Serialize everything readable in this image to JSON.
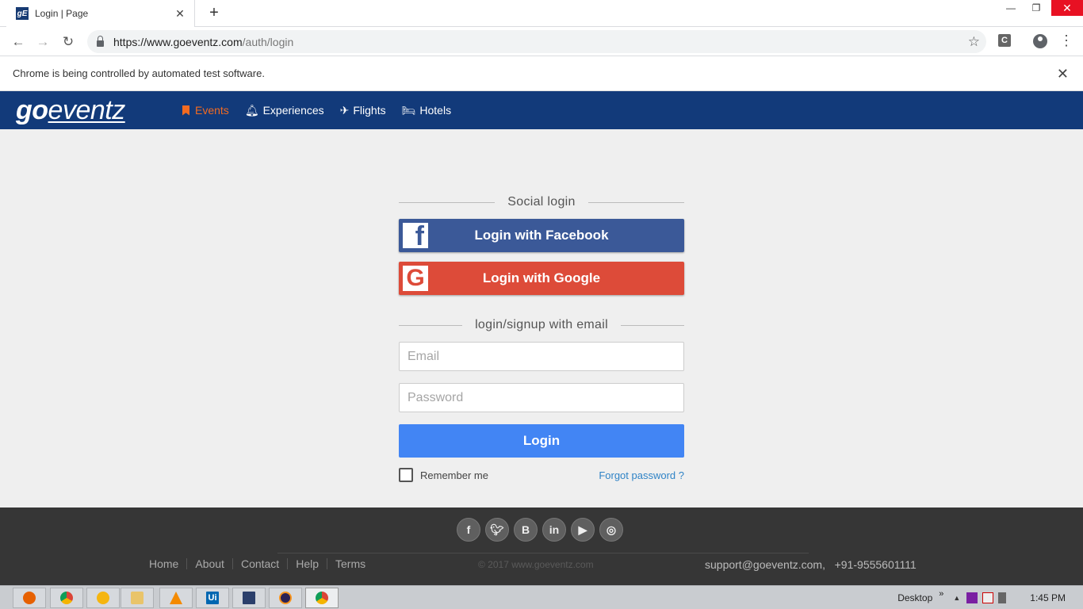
{
  "browser": {
    "tab_title": "Login | Page",
    "tab_favicon_text": "gE",
    "new_tab_symbol": "+",
    "url_host": "https://www.goeventz.com",
    "url_path": "/auth/login",
    "extension_label": "C",
    "infobar_text": "Chrome is being controlled by automated test software."
  },
  "site": {
    "logo_go": "go",
    "logo_eventz": "eventz",
    "nav": [
      {
        "label": "Events",
        "active": true
      },
      {
        "label": "Experiences"
      },
      {
        "label": "Flights"
      },
      {
        "label": "Hotels"
      }
    ]
  },
  "login": {
    "social_heading": "Social login",
    "facebook_label": "Login with Facebook",
    "google_label": "Login with Google",
    "email_heading": "login/signup with email",
    "email_placeholder": "Email",
    "password_placeholder": "Password",
    "login_label": "Login",
    "remember_label": "Remember me",
    "forgot_label": "Forgot password ?"
  },
  "footer": {
    "links": [
      "Home",
      "About",
      "Contact",
      "Help",
      "Terms"
    ],
    "copyright": "© 2017 www.goeventz.com",
    "contact": "support@goeventz.com,   +91-9555601111",
    "social": [
      "facebook-icon",
      "twitter-icon",
      "blog-icon",
      "linkedin-icon",
      "youtube-icon",
      "instagram-icon"
    ]
  },
  "taskbar": {
    "desktop_label": "Desktop",
    "time": "1:45 PM",
    "uipath_label": "Ui"
  },
  "colors": {
    "nav_bg": "#123a7a",
    "accent": "#f36b21",
    "facebook": "#3b5998",
    "google": "#dd4b39",
    "login_btn": "#4285f4",
    "footer_bg": "#363636"
  }
}
